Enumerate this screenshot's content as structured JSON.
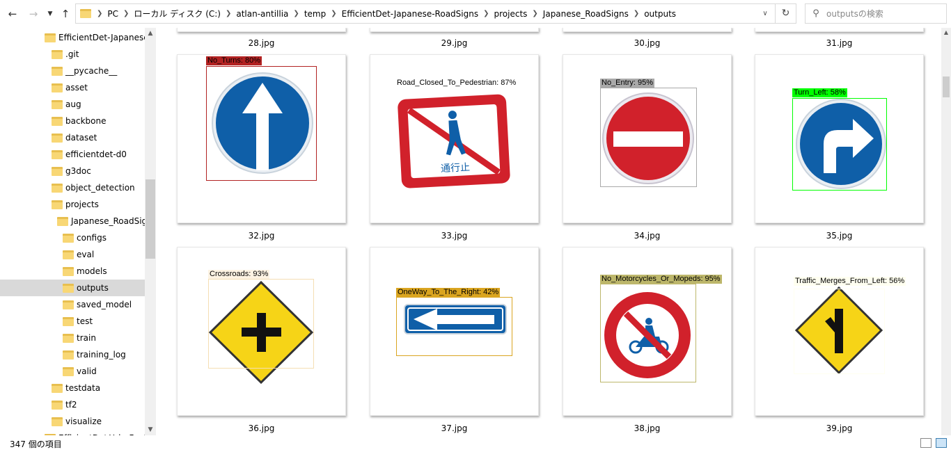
{
  "nav": {
    "back_icon": "arrow-left-icon",
    "forward_icon": "arrow-right-icon",
    "recent_icon": "chevron-down-icon",
    "up_icon": "arrow-up-icon"
  },
  "address": {
    "crumbs": [
      "PC",
      "ローカル ディスク (C:)",
      "atlan-antillia",
      "temp",
      "EfficientDet-Japanese-RoadSigns",
      "projects",
      "Japanese_RoadSigns",
      "outputs"
    ],
    "refresh_icon": "refresh-icon"
  },
  "search": {
    "placeholder": "outputsの検索"
  },
  "tree": [
    {
      "label": "EfficientDet-Japanese-F",
      "level": 0
    },
    {
      "label": ".git",
      "level": 1
    },
    {
      "label": "__pycache__",
      "level": 1
    },
    {
      "label": "asset",
      "level": 1
    },
    {
      "label": "aug",
      "level": 1
    },
    {
      "label": "backbone",
      "level": 1
    },
    {
      "label": "dataset",
      "level": 1
    },
    {
      "label": "efficientdet-d0",
      "level": 1
    },
    {
      "label": "g3doc",
      "level": 1
    },
    {
      "label": "object_detection",
      "level": 1
    },
    {
      "label": "projects",
      "level": 1
    },
    {
      "label": "Japanese_RoadSigns",
      "level": 2
    },
    {
      "label": "configs",
      "level": 3
    },
    {
      "label": "eval",
      "level": 3
    },
    {
      "label": "models",
      "level": 3
    },
    {
      "label": "outputs",
      "level": 3,
      "selected": true
    },
    {
      "label": "saved_model",
      "level": 3
    },
    {
      "label": "test",
      "level": 3
    },
    {
      "label": "train",
      "level": 3
    },
    {
      "label": "training_log",
      "level": 3
    },
    {
      "label": "valid",
      "level": 3
    },
    {
      "label": "testdata",
      "level": 1
    },
    {
      "label": "tf2",
      "level": 1
    },
    {
      "label": "visualize",
      "level": 1
    },
    {
      "label": "EfficientDet-Yolo-Featur",
      "level": 0
    }
  ],
  "prev_row": [
    "28.jpg",
    "29.jpg",
    "30.jpg",
    "31.jpg"
  ],
  "files": [
    {
      "name": "32.jpg",
      "label": "No_Turns: 80%",
      "label_color": "#b22222",
      "box_color": "#b22222"
    },
    {
      "name": "33.jpg",
      "label": "Road_Closed_To_Pedestrian: 87%",
      "label_color": "#ffffff",
      "box_color": "#ffffff"
    },
    {
      "name": "34.jpg",
      "label": "No_Entry: 95%",
      "label_color": "#a9a9a9",
      "box_color": "#a9a9a9"
    },
    {
      "name": "35.jpg",
      "label": "Turn_Left: 58%",
      "label_color": "#00ff00",
      "box_color": "#00ff00"
    },
    {
      "name": "36.jpg",
      "label": "Crossroads: 93%",
      "label_color": "#fdf3e3",
      "box_color": "#f5deb3"
    },
    {
      "name": "37.jpg",
      "label": "OneWay_To_The_Right: 42%",
      "label_color": "#daa520",
      "box_color": "#daa520"
    },
    {
      "name": "38.jpg",
      "label": "No_Motorcycles_Or_Mopeds: 95%",
      "label_color": "#bdb76b",
      "box_color": "#bdb76b"
    },
    {
      "name": "39.jpg",
      "label": "Traffic_Merges_From_Left: 56%",
      "label_color": "#fffff0",
      "box_color": "#fffff0"
    }
  ],
  "status": {
    "count": "347 個の項目"
  },
  "colors": {
    "sign_blue": "#0f5fa8",
    "sign_red": "#d1212b",
    "sign_yellow": "#f6d417",
    "selected_bg": "#d9d9d9"
  }
}
